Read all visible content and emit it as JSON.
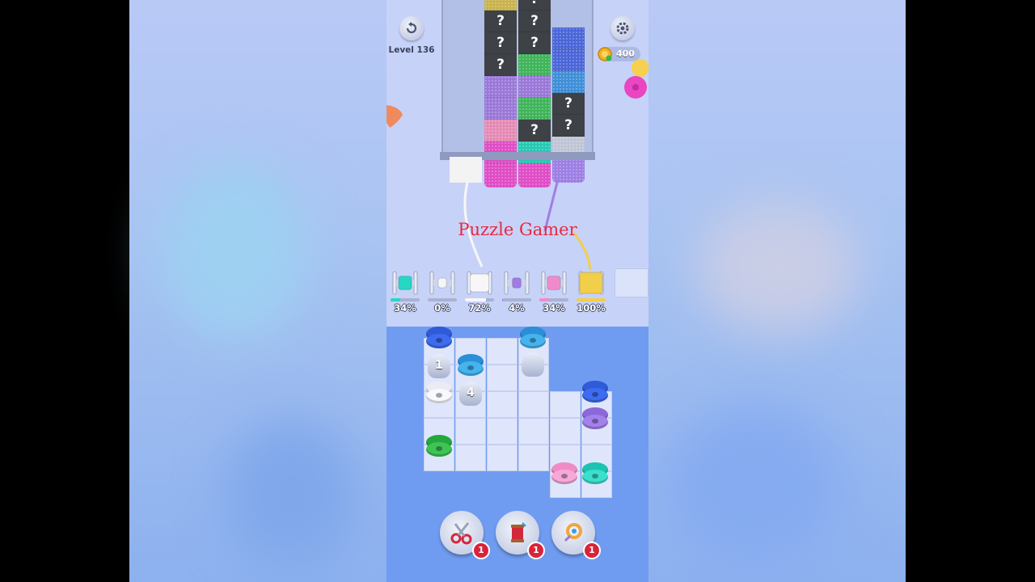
{
  "hud": {
    "level_label": "Level 136",
    "coins": "400",
    "icons": [
      "restart-icon",
      "gear-icon",
      "coin-icon"
    ]
  },
  "machine": {
    "columns": [
      {
        "blocks": [
          "#c9b34d",
          "mystery",
          "mystery",
          "mystery",
          "#9a78d8",
          "#9a78d8",
          "#e58ab5",
          "#e04cc6"
        ],
        "fringe": "#e04cc6"
      },
      {
        "blocks": [
          "mystery",
          "mystery",
          "mystery",
          "#3fb45a",
          "#9a78d8",
          "#3fb45a",
          "mystery",
          "#27c8b4"
        ],
        "fringe": "#e04cc6"
      },
      {
        "blocks": [
          "#4a66d8",
          "#4a66d8",
          "#3f8fd8",
          "mystery",
          "mystery",
          "#bfc5d6"
        ],
        "fringe": "#9d7fe4"
      }
    ],
    "white_fringe": "#f2f2f2",
    "mystery_symbol": "?"
  },
  "watermark": "Puzzle Gamer",
  "spools": [
    {
      "color": "#28d6c4",
      "percent": "34%",
      "fill": 0.34
    },
    {
      "color": "#f4f6fb",
      "percent": "0%",
      "fill": 0.0
    },
    {
      "color": "#f7f7f7",
      "percent": "72%",
      "fill": 0.72
    },
    {
      "color": "#a07be6",
      "percent": "4%",
      "fill": 0.04
    },
    {
      "color": "#f08bcb",
      "percent": "34%",
      "fill": 0.34
    },
    {
      "color": "#f2cf4a",
      "percent": "100%",
      "fill": 1.0
    }
  ],
  "board": {
    "hidden_counts": [
      "1",
      "4"
    ]
  },
  "boosters": [
    {
      "name": "scissors-icon",
      "count": "1"
    },
    {
      "name": "thread-spool-icon",
      "count": "1"
    },
    {
      "name": "magnet-icon",
      "count": "1"
    }
  ]
}
